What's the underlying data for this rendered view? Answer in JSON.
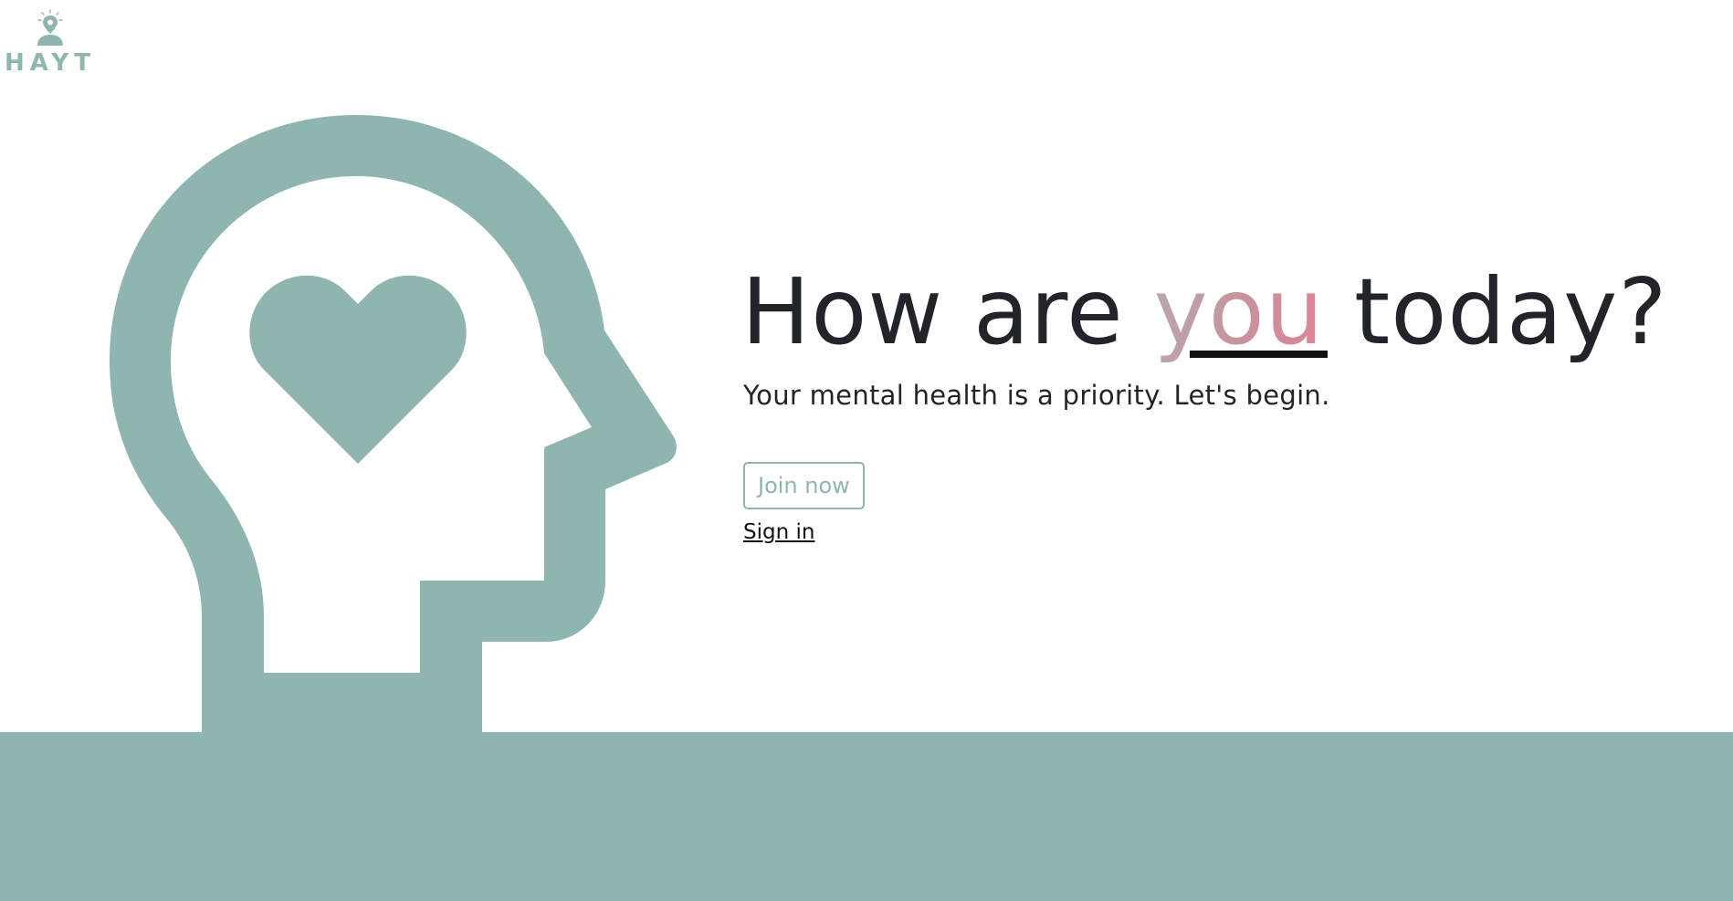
{
  "brand": {
    "name": "HAYT",
    "icon": "location-pin-person-icon",
    "color": "#8fb5b0"
  },
  "hero": {
    "headline_before": "How are ",
    "headline_accent": "you",
    "headline_after": " today?",
    "subtitle": "Your mental health is a priority. Let's begin.",
    "join_button_label": "Join now",
    "signin_link_label": "Sign in"
  },
  "illustration": {
    "icon": "head-with-heart-icon",
    "color": "#8fb5b0"
  },
  "colors": {
    "accent": "#8fb5b0",
    "text": "#212529",
    "highlight_start": "#b9a7ab",
    "highlight_end": "#dc8595",
    "background": "#ffffff"
  }
}
